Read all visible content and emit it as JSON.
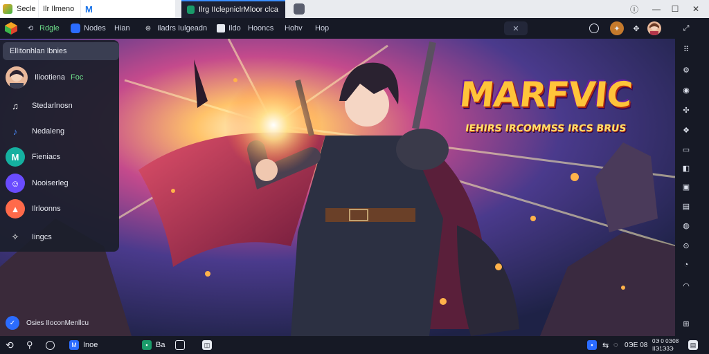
{
  "browser": {
    "tabs": [
      {
        "label": "Secle",
        "icon": "app-icon"
      },
      {
        "label": "Ilr Ilmeno",
        "icon": "page-icon"
      },
      {
        "label": "M",
        "icon": "m-logo-icon"
      },
      {
        "label": "Ilrg IIclepniclrMloor clca",
        "icon": "emulator-icon"
      }
    ],
    "controls": {
      "info": "ⓘ",
      "minimize": "—",
      "maximize": "☐",
      "close": "✕"
    }
  },
  "toolbar": {
    "items": [
      {
        "label": "Rdgle",
        "icon": "home-icon"
      },
      {
        "label": "Nodes",
        "icon": "nodes-icon"
      },
      {
        "label": "Hian",
        "icon": ""
      },
      {
        "label": "Iladrs Iulgeadn",
        "icon": "globe-icon"
      },
      {
        "label": "Ildo",
        "icon": "window-icon"
      },
      {
        "label": "Hooncs",
        "icon": ""
      },
      {
        "label": "Hohv",
        "icon": ""
      },
      {
        "label": "Hop",
        "icon": ""
      }
    ]
  },
  "game": {
    "logo_title": "MARFVIC",
    "logo_subtitle": "IEHIRS IRCOMMSS  IRCS BRUS"
  },
  "menu": {
    "header": "Ellitonhlan lbnies",
    "profile": {
      "name": "Iliootiena",
      "badge": "Foc"
    },
    "items": [
      {
        "label": "Stedarlnosn",
        "icon": "music-note-icon",
        "color": "#3a3e52"
      },
      {
        "label": "Nedaleng",
        "icon": "music-note-icon",
        "color": "#2b6cff"
      },
      {
        "label": "Fieniacs",
        "icon": "m-logo-icon",
        "color": "#15b0a0"
      },
      {
        "label": "Nooiserleg",
        "icon": "chat-icon",
        "color": "#6a4cff"
      },
      {
        "label": "Ilrloonns",
        "icon": "map-icon",
        "color": "#ff6a4a"
      },
      {
        "label": "Iingcs",
        "icon": "sparkle-icon",
        "color": "#3a3e52"
      }
    ],
    "footer": "Osies IIoconMenllcu"
  },
  "navbar": {
    "items": [
      {
        "label": "Inoe",
        "icon": "m-logo-icon"
      },
      {
        "label": "Ba",
        "icon": "app-icon"
      }
    ],
    "clock": {
      "time": "0ЭЕ 08",
      "date_top": "0Э 0 0Э08",
      "date_bottom": "IIЭ1Э3Э"
    }
  },
  "colors": {
    "accent": "#3a8dff",
    "chrome_dark": "#161925",
    "menu_bg": "#1c1f2c"
  }
}
